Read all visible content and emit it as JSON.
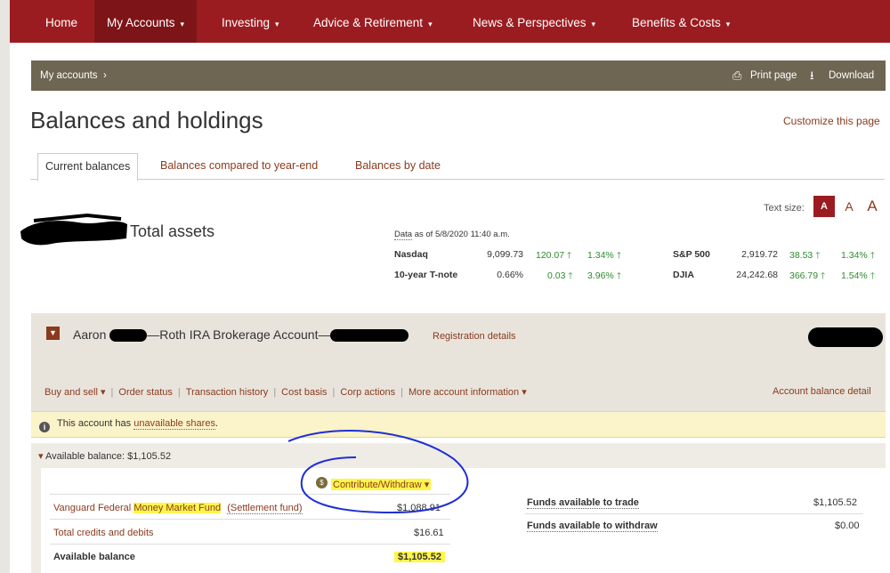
{
  "nav": {
    "items": [
      {
        "label": "Home",
        "caret": false
      },
      {
        "label": "My Accounts",
        "caret": true
      },
      {
        "label": "Investing",
        "caret": true
      },
      {
        "label": "Advice & Retirement",
        "caret": true
      },
      {
        "label": "News & Perspectives",
        "caret": true
      },
      {
        "label": "Benefits & Costs",
        "caret": true
      }
    ]
  },
  "crumb": {
    "label": "My accounts",
    "print": "Print page",
    "download": "Download"
  },
  "page": {
    "title": "Balances and holdings",
    "customize": "Customize this page"
  },
  "tabs": [
    "Current balances",
    "Balances compared to year-end",
    "Balances by date"
  ],
  "textsize": {
    "label": "Text size:",
    "sizes": [
      "A",
      "A",
      "A"
    ]
  },
  "summary": {
    "total_assets": "Total assets"
  },
  "market": {
    "asof_label": "Data",
    "asof_rest": " as of 5/8/2020 11:40 a.m.",
    "rows": [
      {
        "name": "Nasdaq",
        "value": "9,099.73",
        "change": "120.07",
        "pct": "1.34%"
      },
      {
        "name": "10-year T-note",
        "value": "0.66%",
        "change": "0.03",
        "pct": "3.96%"
      }
    ],
    "rows2": [
      {
        "name": "S&P 500",
        "value": "2,919.72",
        "change": "38.53",
        "pct": "1.34%"
      },
      {
        "name": "DJIA",
        "value": "24,242.68",
        "change": "366.79",
        "pct": "1.54%"
      }
    ]
  },
  "account": {
    "owner_first": "Aaron",
    "type": "Roth IRA Brokerage Account",
    "registration": "Registration details",
    "actions": [
      "Buy and sell",
      "Order status",
      "Transaction history",
      "Cost basis",
      "Corp actions",
      "More account information"
    ],
    "balance_detail": "Account balance detail"
  },
  "alert": {
    "prefix": "This account has ",
    "link": "unavailable shares",
    "suffix": "."
  },
  "available": {
    "header": "Available balance: $1,105.52",
    "contribute": "Contribute/Withdraw",
    "fund_prefix": "Vanguard Federal ",
    "fund_hl": "Money Market Fund",
    "fund_suffix": "(Settlement fund)",
    "fund_value": "$1,088.91",
    "credits_label": "Total credits and debits",
    "credits_value": "$16.61",
    "avail_label": "Available balance",
    "avail_value": "$1,105.52",
    "trade_label": "Funds available to trade",
    "trade_value": "$1,105.52",
    "withdraw_label": "Funds available to withdraw",
    "withdraw_value": "$0.00"
  },
  "colors": {
    "brand_red": "#9b1c20",
    "link": "#8b3a1e",
    "highlight": "#fff64a",
    "annotation": "#1f2fd6"
  }
}
